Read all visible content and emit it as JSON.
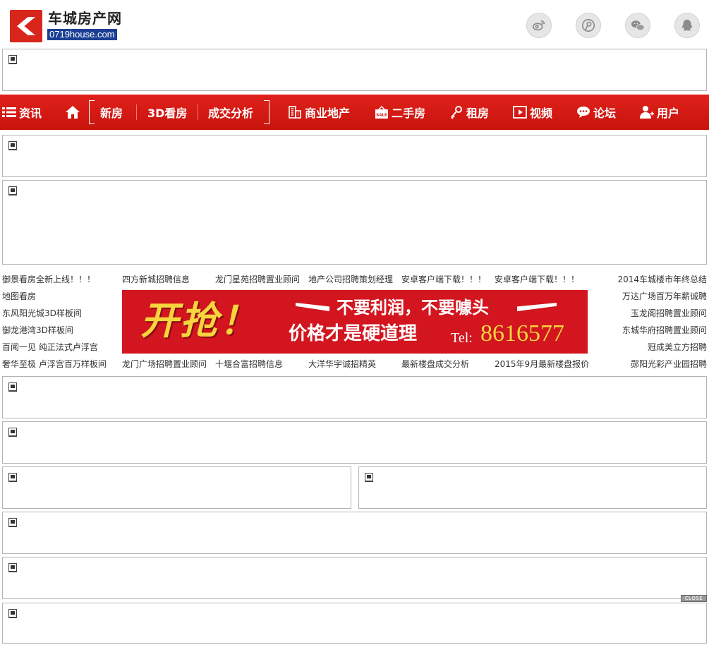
{
  "header": {
    "logo_name": "车城房产网",
    "logo_domain": "0719house.com",
    "social": [
      {
        "icon": "weibo-icon"
      },
      {
        "icon": "tencent-weibo-icon"
      },
      {
        "icon": "wechat-icon"
      },
      {
        "icon": "qq-icon"
      }
    ]
  },
  "nav": {
    "items": [
      {
        "label": "资讯",
        "icon": "list-icon"
      },
      {
        "label": "",
        "icon": "home-icon"
      },
      {
        "label": "新房"
      },
      {
        "label": "3D看房"
      },
      {
        "label": "成交分析"
      },
      {
        "label": "商业地产",
        "icon": "building-icon"
      },
      {
        "label": "二手房",
        "icon": "sale-tag-icon"
      },
      {
        "label": "租房",
        "icon": "key-icon"
      },
      {
        "label": "视频",
        "icon": "play-icon"
      },
      {
        "label": "论坛",
        "icon": "chat-icon"
      },
      {
        "label": "用户",
        "icon": "add-user-icon"
      }
    ]
  },
  "links": {
    "left": [
      "御景看房全新上线！！！",
      "地图看房",
      "东风阳光城3D样板间",
      "御龙港湾3D样板间",
      "百闻一见 纯正法式卢浮宫",
      "奢华至极 卢浮宫百万样板间"
    ],
    "top_row": [
      "四方新城招聘信息",
      "龙门星苑招聘置业顾问",
      "地产公司招聘策划经理",
      "安卓客户端下载！！！",
      "安卓客户端下载！！！"
    ],
    "bottom_row": [
      "龙门广场招聘置业顾问",
      "十堰合富招聘信息",
      "大洋华宇诚招精英",
      "最新楼盘成交分析",
      "2015年9月最新楼盘报价"
    ],
    "right": [
      "2014车城楼市年终总结",
      "万达广场百万年薪诚聘",
      "玉龙阁招聘置业顾问",
      "东城华府招聘置业顾问",
      "冠成美立方招聘",
      "郧阳光彩产业园招聘"
    ]
  },
  "banner": {
    "big": "开抢！",
    "line1": "不要利润，不要噱头",
    "line2": "价格才是硬道理",
    "tel_label": "Tel:",
    "tel": "8616577"
  },
  "close_label": "CLOSE",
  "colors": {
    "nav_red": "#d8190f",
    "banner_red": "#d2151e",
    "banner_yellow": "#f6d53f",
    "logo_blue": "#1c3f94"
  }
}
